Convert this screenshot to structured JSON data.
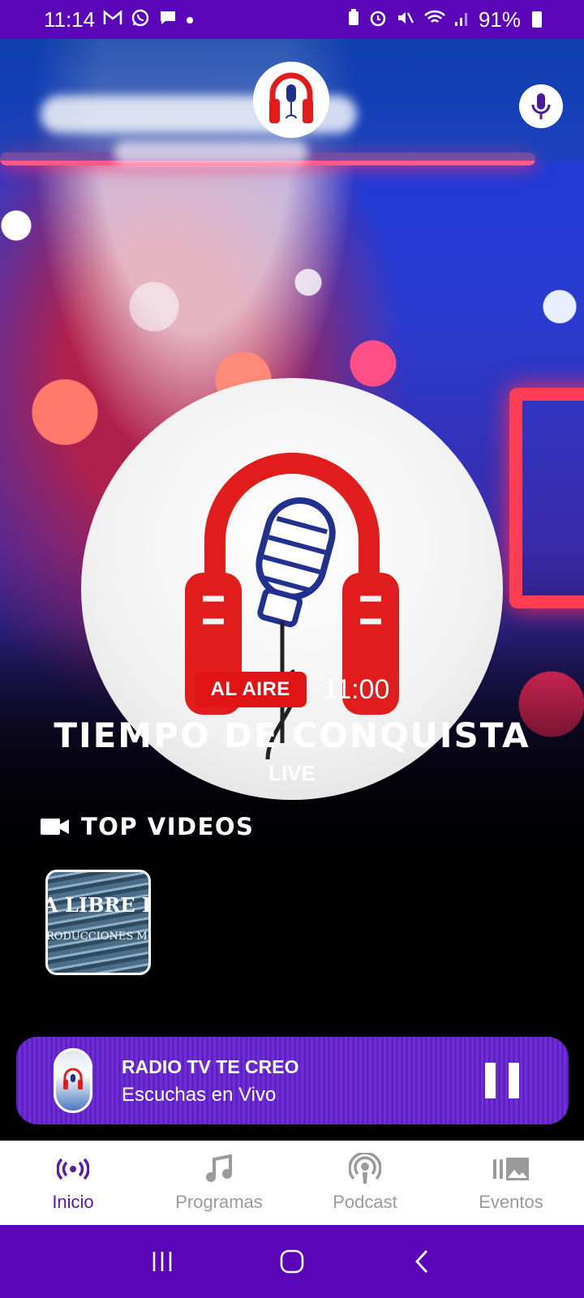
{
  "status_bar": {
    "time": "11:14",
    "battery": "91%",
    "left_icons": [
      "gmail-icon",
      "whatsapp-icon",
      "chat-icon",
      "dot-icon"
    ],
    "right_icons": [
      "battery-saver-icon",
      "alarm-icon",
      "mute-icon",
      "wifi-icon",
      "signal-icon"
    ]
  },
  "header": {
    "logo_icon": "headphones-mic-logo",
    "voice_icon": "mic-icon"
  },
  "now_playing": {
    "badge": "AL AIRE",
    "time": "11:00",
    "title": "TIEMPO DE CONQUISTA",
    "subtitle": "LIVE"
  },
  "top_videos": {
    "heading": "TOP VIDEOS",
    "icon": "video-camera-icon",
    "items": [
      {
        "thumb_line1": "A LIBRE DE D",
        "thumb_line2": "RODUCCIONES MUS"
      }
    ]
  },
  "player": {
    "station": "RADIO TV TE CREO",
    "status": "Escuchas en Vivo",
    "control_icon": "pause-icon"
  },
  "bottom_nav": {
    "items": [
      {
        "label": "Inicio",
        "icon": "broadcast-icon",
        "active": true
      },
      {
        "label": "Programas",
        "icon": "music-note-icon",
        "active": false
      },
      {
        "label": "Podcast",
        "icon": "podcast-icon",
        "active": false
      },
      {
        "label": "Eventos",
        "icon": "gallery-icon",
        "active": false
      }
    ]
  },
  "colors": {
    "brand_purple": "#5a06b8",
    "player_purple": "#6a2ad0",
    "on_air_red": "#e01414",
    "active_nav": "#5a1aa6",
    "inactive_nav": "#9a9a9a"
  }
}
